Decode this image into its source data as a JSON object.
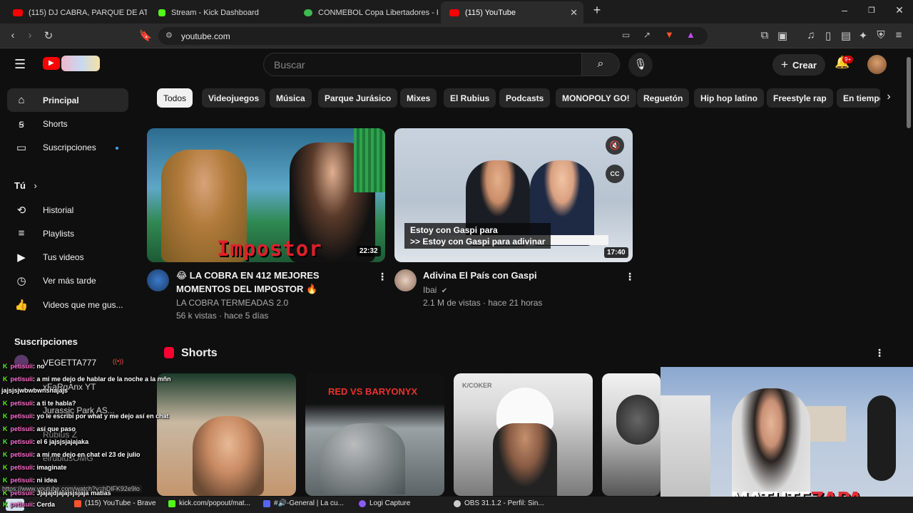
{
  "browser": {
    "tabs": [
      {
        "label": "(115) DJ CABRA, PARQUE DE ATRACC",
        "color": "#ff0000"
      },
      {
        "label": "Stream - Kick Dashboard",
        "color": "#53fc18"
      },
      {
        "label": "CONMEBOL Copa Libertadores - POS",
        "color": "#3fb950"
      },
      {
        "label": "(115) YouTube",
        "color": "#ff0000"
      }
    ],
    "url": "youtube.com"
  },
  "yt": {
    "search_placeholder": "Buscar",
    "create_label": "Crear",
    "notif_badge": "9+"
  },
  "sidebar": {
    "main": [
      {
        "label": "Principal",
        "icon": "home-icon"
      },
      {
        "label": "Shorts",
        "icon": "shorts-icon"
      },
      {
        "label": "Suscripciones",
        "icon": "subscriptions-icon"
      }
    ],
    "you_header": "Tú",
    "you": [
      {
        "label": "Historial",
        "icon": "history-icon"
      },
      {
        "label": "Playlists",
        "icon": "playlists-icon"
      },
      {
        "label": "Tus videos",
        "icon": "your-videos-icon"
      },
      {
        "label": "Ver más tarde",
        "icon": "watch-later-icon"
      },
      {
        "label": "Videos que me gus...",
        "icon": "liked-icon"
      }
    ],
    "subs_header": "Suscripciones",
    "subs": [
      "VEGETTA777",
      "xFaRgAnx YT",
      "Jurassic Park AS...",
      "Rubius Z",
      "elrubiusOMG"
    ]
  },
  "chips": [
    "Todos",
    "Videojuegos",
    "Música",
    "Parque Jurásico",
    "Mixes",
    "El Rubius",
    "Podcasts",
    "MONOPOLY GO!",
    "Reguetón",
    "Hip hop latino",
    "Freestyle rap",
    "En tiempo"
  ],
  "videos": [
    {
      "title1": "😂 LA COBRA EN 412 MEJORES",
      "title2": "MOMENTOS DEL IMPOSTOR 🔥",
      "channel": "LA COBRA TERMEADAS 2.0",
      "meta": "56 k vistas · hace 5 días",
      "duration": "22:32",
      "overlay": "Impostor"
    },
    {
      "title1": "Adivina El País con Gaspi",
      "channel": "Ibai",
      "meta": "2.1 M de vistas · hace 21 horas",
      "duration": "17:40",
      "caption1": "Estoy con Gaspi para",
      "caption2": ">> Estoy con Gaspi para adivinar"
    }
  ],
  "shorts": {
    "header": "Shorts",
    "short2_text": "RED VS BARYONYX",
    "short3_text": "K/COKER"
  },
  "chat": [
    {
      "user": "petisuii",
      "msg": ": no"
    },
    {
      "user": "petisuii",
      "msg": ": a mi me dejo de hablar de la noche a la mñn"
    },
    {
      "user": "",
      "msg": "jajsjsjwbwbwnshajajs"
    },
    {
      "user": "petisuii",
      "msg": ": a ti te habla?"
    },
    {
      "user": "petisuii",
      "msg": ": yo le escribi por what y me dejo así en chat"
    },
    {
      "user": "petisuii",
      "msg": ": así que paso"
    },
    {
      "user": "petisuii",
      "msg": ": el 6 jajsjsjajajaka"
    },
    {
      "user": "petisuii",
      "msg": ": a mi me dejo en chat el 23 de julio"
    },
    {
      "user": "petisuii",
      "msg": ": imaginate"
    },
    {
      "user": "petisuii",
      "msg": ": ni idea"
    },
    {
      "user": "petisuii",
      "msg": ": Jjajajdjajajsjsjaja matias"
    },
    {
      "user": "petisuii",
      "msg": ": Cerda"
    }
  ],
  "status_url": "https://www.youtube.com/watch?v=hDlFK92e9lo",
  "taskbar": [
    {
      "label": "(115) YouTube - Brave",
      "color": "#fb542b"
    },
    {
      "label": "kick.com/popout/mat...",
      "color": "#53fc18"
    },
    {
      "label": "#🔊-General | La cu...",
      "color": "#5865f2"
    },
    {
      "label": "Logi Capture",
      "color": "#8a5cf6"
    },
    {
      "label": "OBS 31.1.2 - Perfil: Sin...",
      "color": "#cccccc"
    }
  ],
  "cam_name_a": "MATUTE",
  "cam_name_b": "ZAPA"
}
